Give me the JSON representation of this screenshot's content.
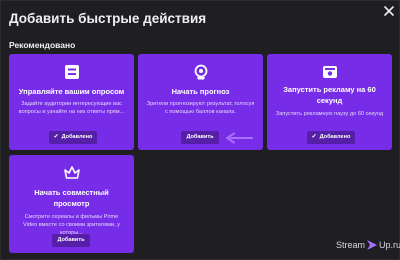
{
  "dialog": {
    "title": "Добавить быстрые действия",
    "section_title": "Рекомендовано"
  },
  "cards": [
    {
      "title": "Управляйте вашим опросом",
      "description": "Задайте аудитории интересующие вас вопросы и узнайте на них ответы прям...",
      "button": "Добавлено",
      "icon": "poll-icon"
    },
    {
      "title": "Начать прогноз",
      "description": "Зрители прогнозируют результат, голосуя с помощью баллов канала.",
      "button": "Добавить",
      "icon": "prediction-icon"
    },
    {
      "title": "Запустить рекламу на 60 секунд",
      "description": "Запустить рекламную паузу до 60 секунд",
      "button": "Добавлено",
      "icon": "ad-icon"
    },
    {
      "title": "Начать совместный просмотр",
      "description": "Смотрите сериалы и фильмы Prime Video вместе со своими зрителями, у которы...",
      "button": "Добавить",
      "icon": "crown-icon"
    }
  ],
  "watermark": {
    "left": "Stream",
    "right": "Up.ru"
  },
  "colors": {
    "card": "#772ce8",
    "background": "#1f1f23",
    "arrow": "#a970ff"
  }
}
